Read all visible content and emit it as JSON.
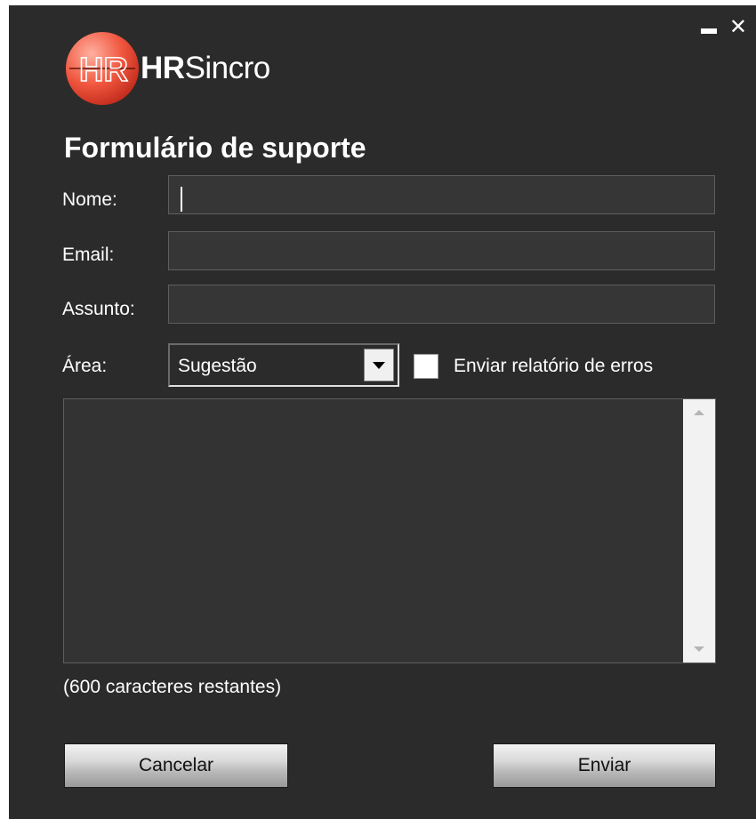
{
  "window": {
    "minimize_icon": "minimize-icon",
    "close_icon": "close-icon",
    "close_glyph": "✕"
  },
  "logo": {
    "mark": "HR",
    "brand_bold": "HR",
    "brand_rest": "Sincro",
    "colors": {
      "primary": "#f0563e",
      "dark": "#8e1d12"
    }
  },
  "form": {
    "title": "Formulário de suporte",
    "name_label": "Nome:",
    "name_value": "",
    "email_label": "Email:",
    "email_value": "",
    "subject_label": "Assunto:",
    "subject_value": "",
    "area_label": "Área:",
    "area_selected": "Sugestão",
    "error_report_label": "Enviar relatório de erros",
    "error_report_checked": false,
    "message_value": "",
    "remaining": "(600 caracteres restantes)",
    "cancel_label": "Cancelar",
    "send_label": "Enviar"
  },
  "colors": {
    "window_bg": "#2b2b2b",
    "input_bg": "#363636",
    "input_border": "#5e5e5e",
    "text": "#ffffff"
  }
}
